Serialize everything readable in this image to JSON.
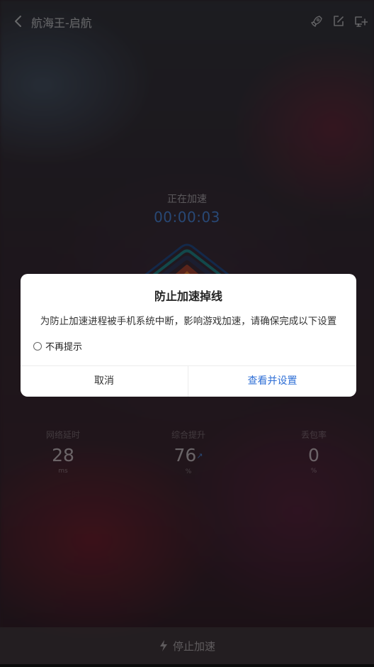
{
  "header": {
    "title": "航海王-启航",
    "icons": [
      "back-icon",
      "rocket-icon",
      "edit-icon",
      "add-shortcut-icon"
    ]
  },
  "accel": {
    "status": "正在加速",
    "timer": "00:00:03"
  },
  "stats": [
    {
      "label": "网络延时",
      "value": "28",
      "unit": "ms"
    },
    {
      "label": "综合提升",
      "value": "76",
      "unit": "%"
    },
    {
      "label": "丢包率",
      "value": "0",
      "unit": "%"
    }
  ],
  "bottom": {
    "stop_label": "停止加速"
  },
  "dialog": {
    "title": "防止加速掉线",
    "message": "为防止加速进程被手机系统中断，影响游戏加速，请确保完成以下设置",
    "checkbox_label": "不再提示",
    "cancel_label": "取消",
    "confirm_label": "查看并设置"
  },
  "colors": {
    "accent": "#2f6fd6",
    "timer": "#3e6fb4"
  }
}
